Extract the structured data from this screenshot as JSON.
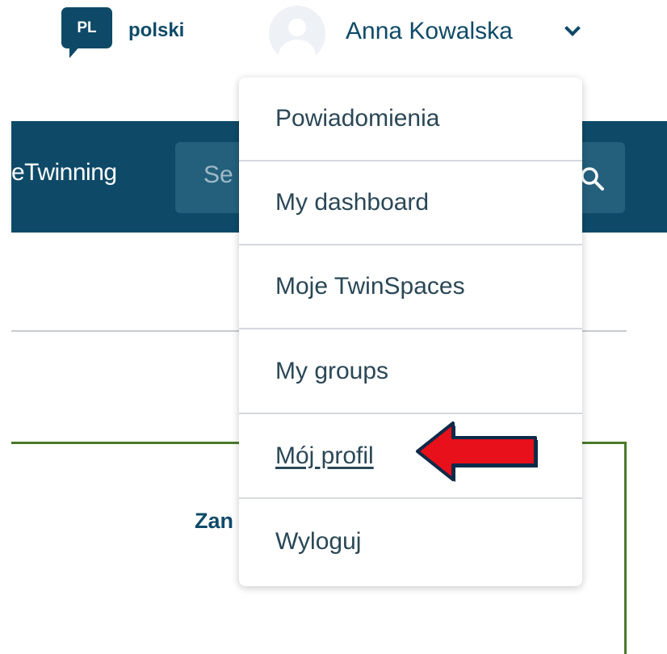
{
  "header": {
    "language_code": "PL",
    "language_name": "polski",
    "user_name": "Anna Kowalska",
    "icons": {
      "avatar": "avatar-icon",
      "chevron": "chevron-down-icon"
    }
  },
  "nav": {
    "brand": "eTwinning",
    "search_placeholder": "Se",
    "search_icon": "search-icon"
  },
  "content": {
    "heading": "Zan"
  },
  "dropdown": {
    "items": [
      {
        "label": "Powiadomienia"
      },
      {
        "label": "My dashboard"
      },
      {
        "label": "Moje TwinSpaces"
      },
      {
        "label": "My groups"
      },
      {
        "label": "Mój profil"
      },
      {
        "label": "Wyloguj"
      }
    ]
  },
  "colors": {
    "brand": "#0e4a68",
    "search_bg": "#24607c",
    "frame_green": "#4a7a2a",
    "annotation_red": "#e8101a"
  }
}
